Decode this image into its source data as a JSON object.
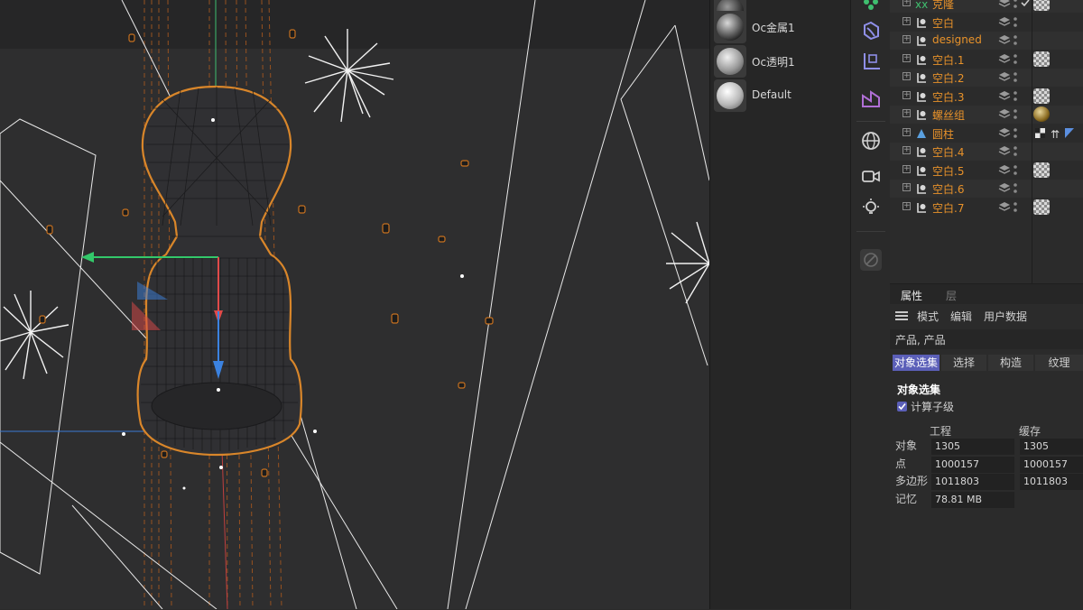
{
  "materials": [
    {
      "label": "Oc金属1",
      "style": "metal"
    },
    {
      "label": "Oc透明1",
      "style": "glass"
    },
    {
      "label": "Default",
      "style": "default"
    }
  ],
  "toolbar_icons": [
    "cloner-icon",
    "deformer-icon",
    "coordinate-icon",
    "spline-pen-icon",
    "globe-icon",
    "camera-icon",
    "light-icon",
    "edit-pen-icon"
  ],
  "objects": [
    {
      "name": "克隆",
      "icon": "cloner",
      "tag": "checker",
      "check": true
    },
    {
      "name": "空白",
      "icon": "null",
      "tag": ""
    },
    {
      "name": "designed",
      "icon": "null",
      "tag": ""
    },
    {
      "name": "空白.1",
      "icon": "null",
      "tag": "checker"
    },
    {
      "name": "空白.2",
      "icon": "null",
      "tag": ""
    },
    {
      "name": "空白.3",
      "icon": "null",
      "tag": "checker"
    },
    {
      "name": "螺丝组",
      "icon": "null",
      "tag": "gold"
    },
    {
      "name": "圆柱",
      "icon": "cylinder",
      "tag": "multi"
    },
    {
      "name": "空白.4",
      "icon": "null",
      "tag": ""
    },
    {
      "name": "空白.5",
      "icon": "null",
      "tag": "checker"
    },
    {
      "name": "空白.6",
      "icon": "null",
      "tag": ""
    },
    {
      "name": "空白.7",
      "icon": "null",
      "tag": "checker"
    }
  ],
  "attributes": {
    "tabs": [
      "属性",
      "层"
    ],
    "menu": [
      "模式",
      "编辑",
      "用户数据"
    ],
    "object_title": "产品, 产品",
    "subtabs": [
      "对象选集",
      "选择",
      "构造",
      "纹理"
    ],
    "section": "对象选集",
    "checkbox_label": "计算子级",
    "checkbox_checked": true,
    "col_project": "工程",
    "col_cache": "缓存",
    "stats": [
      {
        "label": "对象",
        "project": "1305",
        "cache": "1305"
      },
      {
        "label": "点",
        "project": "1000157",
        "cache": "1000157"
      },
      {
        "label": "多边形",
        "project": "1011803",
        "cache": "1011803"
      },
      {
        "label": "记忆",
        "project": "78.81 MB",
        "cache": ""
      }
    ]
  },
  "colors": {
    "accent": "#5b5fb8",
    "object_name": "#e8922a",
    "selection_outline": "#d9862a",
    "viewport_bg": "#2e2e2f"
  }
}
